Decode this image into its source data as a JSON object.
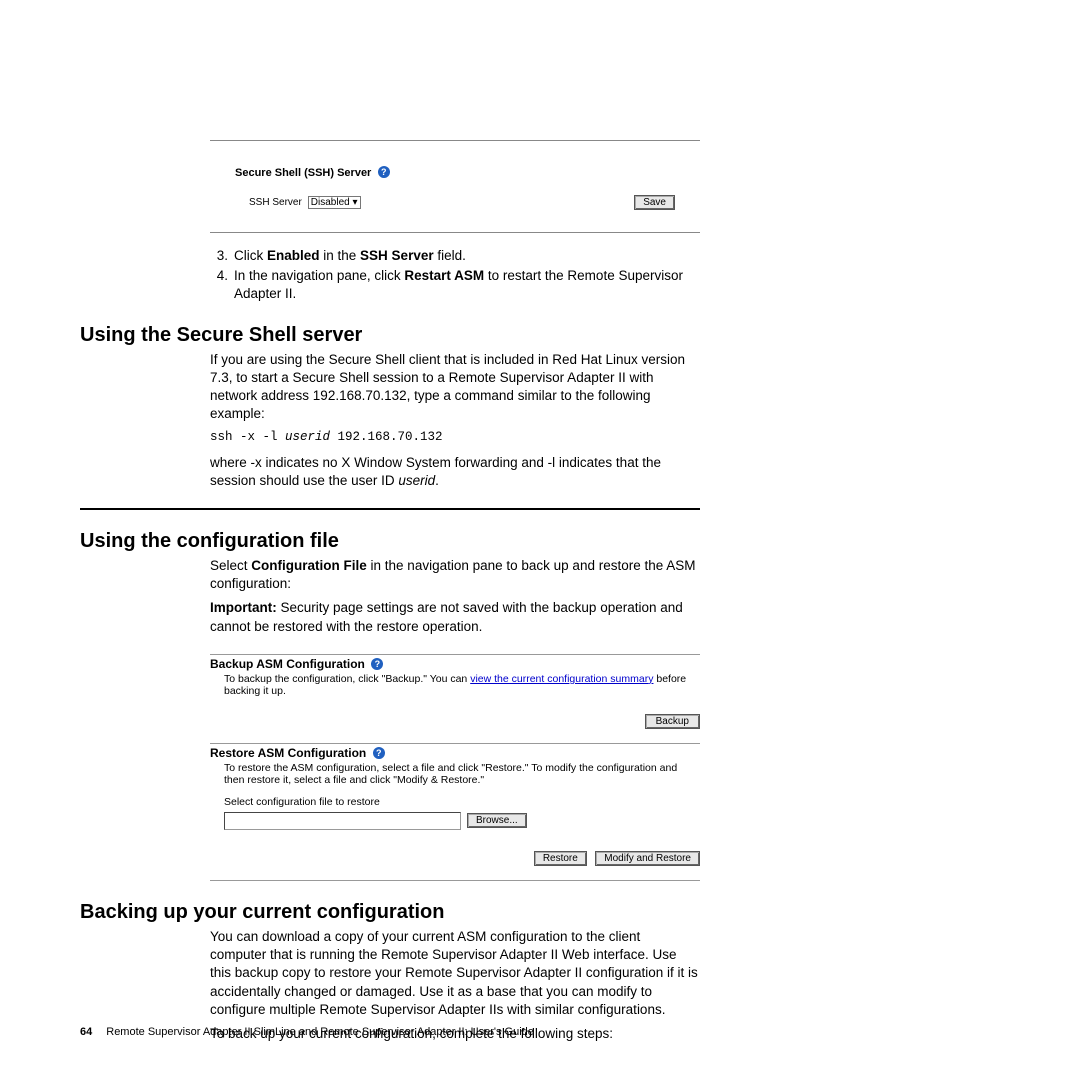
{
  "ssh_panel": {
    "title": "Secure Shell (SSH) Server",
    "label": "SSH Server",
    "selected": "Disabled",
    "save": "Save"
  },
  "steps": {
    "s3_pre": "Click ",
    "s3_b1": "Enabled",
    "s3_mid": " in the ",
    "s3_b2": "SSH Server",
    "s3_post": " field.",
    "s4_pre": "In the navigation pane, click ",
    "s4_b1": "Restart ASM",
    "s4_post": " to restart the Remote Supervisor Adapter II."
  },
  "sec1": {
    "heading": "Using the Secure Shell server",
    "p1": "If you are using the Secure Shell client that is included in Red Hat Linux version 7.3, to start a Secure Shell session to a Remote Supervisor Adapter II with network address 192.168.70.132, type a command similar to the following example:",
    "cmd_pre": "ssh -x -l ",
    "cmd_it": "userid",
    "cmd_post": " 192.168.70.132",
    "p2_pre": "where -x indicates no X Window System forwarding and -l indicates that the session should use the user ID ",
    "p2_it": "userid",
    "p2_post": "."
  },
  "sec2": {
    "heading": "Using the configuration file",
    "p1_pre": "Select ",
    "p1_b": "Configuration File",
    "p1_post": " in the navigation pane to back up and restore the ASM configuration:",
    "imp_b": "Important:",
    "imp_post": " Security page settings are not saved with the backup operation and cannot be restored with the restore operation."
  },
  "config_shot": {
    "backup_title": "Backup ASM Configuration",
    "backup_desc_pre": "To backup the configuration, click \"Backup.\" You can ",
    "backup_link": "view the current configuration summary",
    "backup_desc_post": " before backing it up.",
    "backup_btn": "Backup",
    "restore_title": "Restore ASM Configuration",
    "restore_desc": "To restore the ASM configuration, select a file and click \"Restore.\" To modify the configuration and then restore it, select a file and click \"Modify & Restore.\"",
    "restore_label": "Select configuration file to restore",
    "browse": "Browse...",
    "restore_btn": "Restore",
    "modify_btn": "Modify and Restore"
  },
  "sec3": {
    "heading": "Backing up your current configuration",
    "p1": "You can download a copy of your current ASM configuration to the client computer that is running the Remote Supervisor Adapter II Web interface. Use this backup copy to restore your Remote Supervisor Adapter II configuration if it is accidentally changed or damaged. Use it as a base that you can modify to configure multiple Remote Supervisor Adapter IIs with similar configurations.",
    "p2": "To back up your current configuration, complete the following steps:"
  },
  "footer": {
    "page": "64",
    "title": "Remote Supervisor Adapter II SlimLine and Remote Supervisor Adapter II:  User's Guide"
  }
}
